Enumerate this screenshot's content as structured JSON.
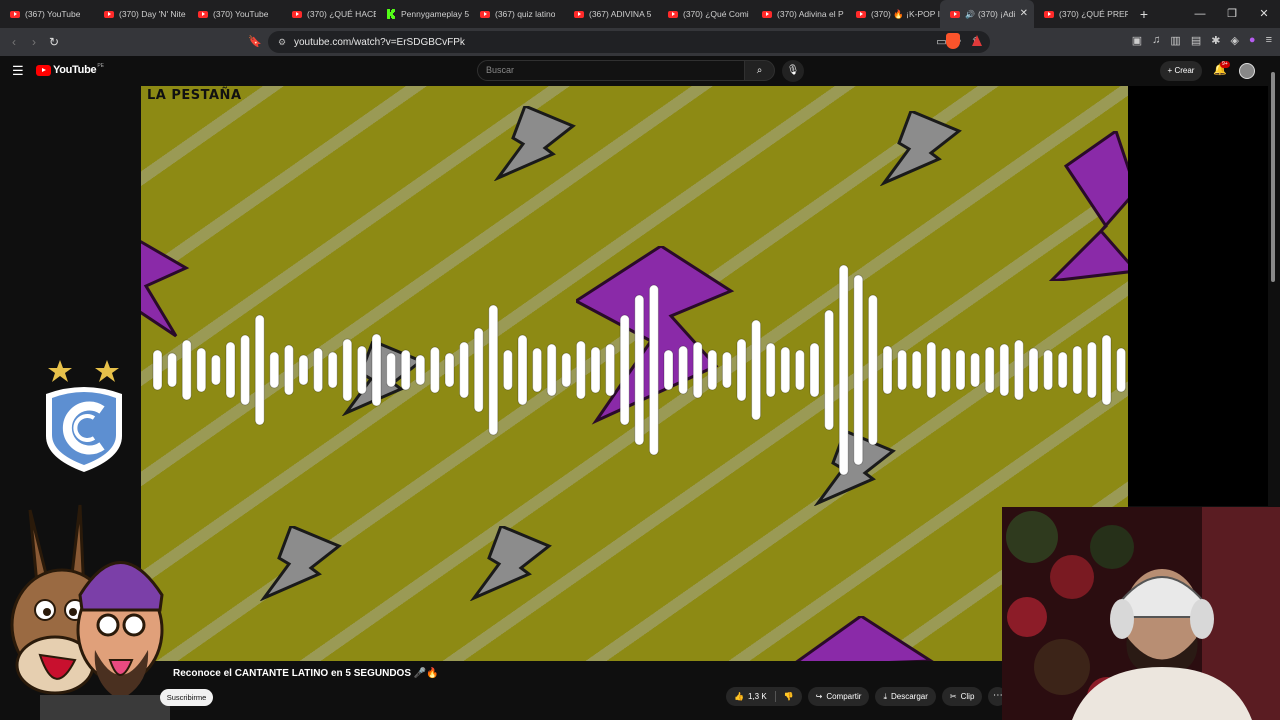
{
  "browser": {
    "tabs": [
      {
        "title": "(367) YouTube",
        "icon": "youtube-icon"
      },
      {
        "title": "(370) Day 'N' Nite",
        "icon": "youtube-icon"
      },
      {
        "title": "(370) YouTube",
        "icon": "youtube-icon"
      },
      {
        "title": "(370) ¿QUÉ HACE",
        "icon": "youtube-icon"
      },
      {
        "title": "Pennygameplay 5",
        "icon": "kick-icon"
      },
      {
        "title": "(367) quiz latino",
        "icon": "youtube-icon"
      },
      {
        "title": "(367) ADIVINA 5",
        "icon": "youtube-icon"
      },
      {
        "title": "(370) ¿Qué Comi",
        "icon": "youtube-icon"
      },
      {
        "title": "(370) Adivina el P",
        "icon": "youtube-icon"
      },
      {
        "title": "(370) 🔥 ¡K-POP I",
        "icon": "youtube-icon"
      },
      {
        "title": "(370) ¡Adi",
        "icon": "youtube-icon",
        "active": true
      },
      {
        "title": "(370) ¿QUÉ PREF",
        "icon": "youtube-icon"
      }
    ],
    "url": "youtube.com/watch?v=ErSDGBCvFPk",
    "accent_youtube": "#ff0000",
    "accent_kick": "#53fc18"
  },
  "youtube": {
    "logo_text": "YouTube",
    "country_code": "PE",
    "search_placeholder": "Buscar",
    "create_label": "Crear",
    "notification_badge": "9+"
  },
  "video": {
    "watermark": "LA PESTAÑA",
    "title": "Reconoce el CANTANTE LATINO en 5 SEGUNDOS 🎤🔥",
    "subscribe_label": "Suscribirme",
    "likes": "1,3 K",
    "share_label": "Compartir",
    "download_label": "Descargar",
    "clip_label": "Clip"
  }
}
